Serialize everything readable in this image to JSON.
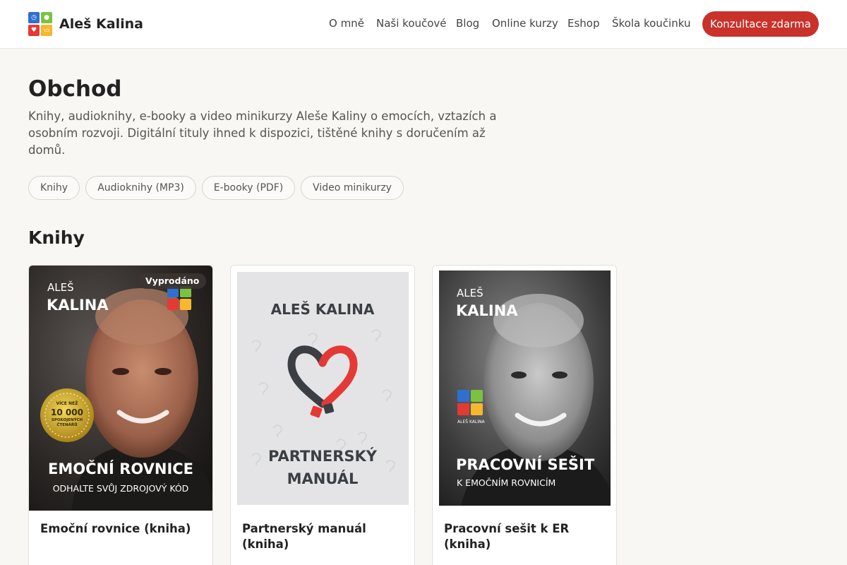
{
  "brand": {
    "name": "Aleš Kalina"
  },
  "nav": {
    "items": [
      {
        "label": "O mně"
      },
      {
        "label": "Naši koučové"
      },
      {
        "label": "Blog"
      },
      {
        "label": "Online kurzy"
      },
      {
        "label": "Eshop"
      },
      {
        "label": "Škola koučinku"
      }
    ],
    "cta": "Konzultace zdarma"
  },
  "page": {
    "title": "Obchod",
    "description": "Knihy, audioknihy, e-booky a video minikurzy Aleše Kaliny o emocích, vztazích a osobním rozvoji. Digitální tituly ihned k dispozici, tištěné knihy s doručením až domů."
  },
  "filters": [
    {
      "label": "Knihy"
    },
    {
      "label": "Audioknihy (MP3)"
    },
    {
      "label": "E-booky (PDF)"
    },
    {
      "label": "Video minikurzy"
    }
  ],
  "section": {
    "title": "Knihy"
  },
  "products": [
    {
      "title": "Emoční rovnice (kniha)",
      "badge": "Vyprodáno",
      "cover": {
        "author_first": "ALEŠ",
        "author_last": "KALINA",
        "seal_line1": "VÍCE NEŽ",
        "seal_line2": "10 000",
        "seal_line3": "SPOKOJENÝCH",
        "seal_line4": "ČTENÁŘŮ",
        "headline": "EMOČNÍ ROVNICE",
        "subline": "ODHALTE SVŮJ ZDROJOVÝ KÓD"
      }
    },
    {
      "title": "Partnerský manuál (kniha)",
      "cover": {
        "author": "ALEŠ KALINA",
        "headline1": "PARTNERSKÝ",
        "headline2": "MANUÁL"
      }
    },
    {
      "title": "Pracovní sešit k ER (kniha)",
      "cover": {
        "author_first": "ALEŠ",
        "author_last": "KALINA",
        "logo_caption": "ALEŠ KALINA",
        "headline": "PRACOVNÍ SEŠIT",
        "subline": "K EMOČNÍM ROVNICÍM"
      }
    }
  ],
  "colors": {
    "accent": "#c8322b",
    "logo_blue": "#2f6fd1",
    "logo_green": "#7cc242",
    "logo_red": "#e53935",
    "logo_yellow": "#f5b82e"
  }
}
